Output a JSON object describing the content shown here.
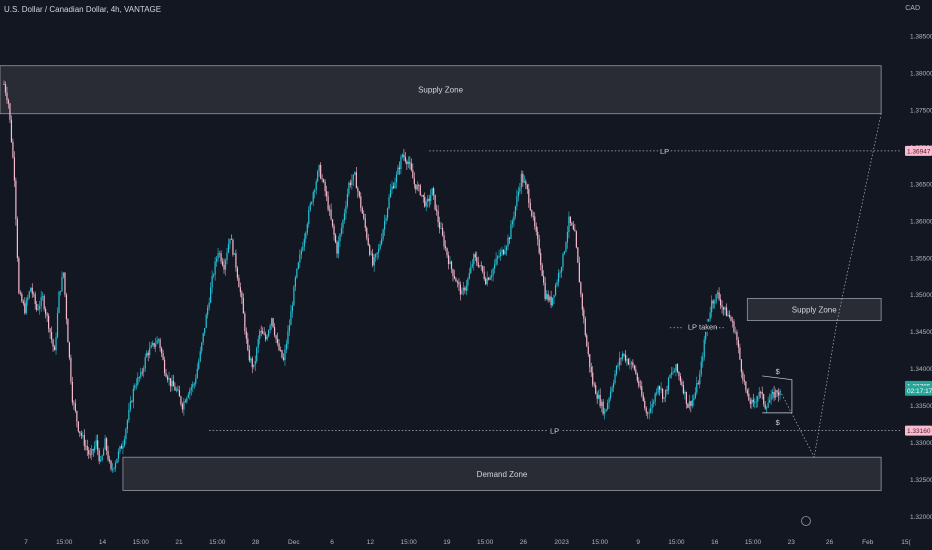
{
  "header": {
    "title": "U.S. Dollar / Canadian Dollar, 4h, VANTAGE",
    "currency": "CAD"
  },
  "colors": {
    "background": "#131722",
    "up": "#26c6da",
    "down": "#f8bbd0",
    "zone_fill": "#2e3038",
    "zone_border": "#9598a1",
    "text": "#d1d4dc",
    "dotted": "#b2b5be",
    "price_tag_pink": "#f8bbd0",
    "price_tag_teal": "#26a69a"
  },
  "chart_data": {
    "type": "candlestick",
    "symbol": "USDCAD",
    "timeframe": "4h",
    "ylim": [
      1.3195,
      1.388
    ],
    "y_ticks": [
      "1.38500",
      "1.38000",
      "1.37500",
      "1.37000",
      "1.36500",
      "1.36000",
      "1.35500",
      "1.35000",
      "1.34500",
      "1.34000",
      "1.33500",
      "1.33000",
      "1.32500",
      "1.32000"
    ],
    "x_ticks": [
      "7",
      "15:00",
      "14",
      "15:00",
      "21",
      "15:00",
      "28",
      "Dec",
      "6",
      "12",
      "15:00",
      "19",
      "15:00",
      "26",
      "2023",
      "15:00",
      "9",
      "15:00",
      "16",
      "15:00",
      "23",
      "26",
      "Feb",
      "15("
    ],
    "price_path": [
      [
        0,
        1.3785
      ],
      [
        3,
        1.376
      ],
      [
        7,
        1.366
      ],
      [
        10,
        1.35
      ],
      [
        14,
        1.348
      ],
      [
        18,
        1.351
      ],
      [
        22,
        1.348
      ],
      [
        26,
        1.3495
      ],
      [
        30,
        1.346
      ],
      [
        34,
        1.342
      ],
      [
        37,
        1.35
      ],
      [
        40,
        1.353
      ],
      [
        43,
        1.344
      ],
      [
        46,
        1.336
      ],
      [
        50,
        1.332
      ],
      [
        54,
        1.33
      ],
      [
        58,
        1.328
      ],
      [
        62,
        1.33
      ],
      [
        65,
        1.327
      ],
      [
        68,
        1.33
      ],
      [
        72,
        1.326
      ],
      [
        76,
        1.328
      ],
      [
        80,
        1.33
      ],
      [
        84,
        1.334
      ],
      [
        88,
        1.338
      ],
      [
        92,
        1.339
      ],
      [
        96,
        1.342
      ],
      [
        100,
        1.343
      ],
      [
        104,
        1.344
      ],
      [
        108,
        1.34
      ],
      [
        112,
        1.338
      ],
      [
        116,
        1.337
      ],
      [
        120,
        1.335
      ],
      [
        124,
        1.337
      ],
      [
        128,
        1.338
      ],
      [
        132,
        1.342
      ],
      [
        136,
        1.347
      ],
      [
        140,
        1.352
      ],
      [
        144,
        1.356
      ],
      [
        148,
        1.354
      ],
      [
        152,
        1.358
      ],
      [
        156,
        1.354
      ],
      [
        160,
        1.349
      ],
      [
        164,
        1.342
      ],
      [
        168,
        1.34
      ],
      [
        172,
        1.345
      ],
      [
        176,
        1.344
      ],
      [
        180,
        1.347
      ],
      [
        184,
        1.343
      ],
      [
        188,
        1.341
      ],
      [
        192,
        1.346
      ],
      [
        196,
        1.352
      ],
      [
        200,
        1.356
      ],
      [
        204,
        1.36
      ],
      [
        208,
        1.364
      ],
      [
        212,
        1.367
      ],
      [
        216,
        1.364
      ],
      [
        220,
        1.36
      ],
      [
        224,
        1.356
      ],
      [
        228,
        1.36
      ],
      [
        232,
        1.365
      ],
      [
        236,
        1.366
      ],
      [
        240,
        1.362
      ],
      [
        244,
        1.358
      ],
      [
        248,
        1.354
      ],
      [
        252,
        1.356
      ],
      [
        256,
        1.36
      ],
      [
        260,
        1.364
      ],
      [
        264,
        1.366
      ],
      [
        268,
        1.369
      ],
      [
        272,
        1.368
      ],
      [
        276,
        1.365
      ],
      [
        280,
        1.364
      ],
      [
        284,
        1.362
      ],
      [
        288,
        1.364
      ],
      [
        292,
        1.36
      ],
      [
        296,
        1.357
      ],
      [
        300,
        1.354
      ],
      [
        304,
        1.352
      ],
      [
        308,
        1.35
      ],
      [
        312,
        1.352
      ],
      [
        316,
        1.355
      ],
      [
        320,
        1.354
      ],
      [
        324,
        1.352
      ],
      [
        328,
        1.353
      ],
      [
        332,
        1.355
      ],
      [
        336,
        1.356
      ],
      [
        340,
        1.358
      ],
      [
        344,
        1.362
      ],
      [
        348,
        1.366
      ],
      [
        352,
        1.364
      ],
      [
        356,
        1.36
      ],
      [
        360,
        1.356
      ],
      [
        364,
        1.35
      ],
      [
        368,
        1.349
      ],
      [
        372,
        1.352
      ],
      [
        376,
        1.355
      ],
      [
        380,
        1.36
      ],
      [
        384,
        1.358
      ],
      [
        388,
        1.35
      ],
      [
        392,
        1.343
      ],
      [
        396,
        1.338
      ],
      [
        400,
        1.336
      ],
      [
        404,
        1.334
      ],
      [
        408,
        1.337
      ],
      [
        412,
        1.34
      ],
      [
        416,
        1.342
      ],
      [
        420,
        1.341
      ],
      [
        424,
        1.34
      ],
      [
        428,
        1.337
      ],
      [
        432,
        1.334
      ],
      [
        436,
        1.335
      ],
      [
        440,
        1.338
      ],
      [
        444,
        1.336
      ],
      [
        448,
        1.339
      ],
      [
        452,
        1.34
      ],
      [
        456,
        1.338
      ],
      [
        460,
        1.335
      ],
      [
        464,
        1.336
      ],
      [
        468,
        1.339
      ],
      [
        472,
        1.345
      ],
      [
        476,
        1.349
      ],
      [
        480,
        1.35
      ],
      [
        484,
        1.348
      ],
      [
        488,
        1.347
      ],
      [
        492,
        1.345
      ],
      [
        496,
        1.34
      ],
      [
        500,
        1.336
      ],
      [
        504,
        1.335
      ],
      [
        508,
        1.337
      ],
      [
        512,
        1.335
      ],
      [
        516,
        1.336
      ],
      [
        520,
        1.337
      ],
      [
        522,
        1.3365
      ]
    ],
    "zones": [
      {
        "label": "Supply Zone",
        "top": 1.381,
        "bottom": 1.3745,
        "x_start": 0,
        "x_end": 590
      },
      {
        "label": "Supply Zone",
        "top": 1.3495,
        "bottom": 1.3465,
        "x_start": 500,
        "x_end": 590
      },
      {
        "label": "Demand Zone",
        "top": 1.328,
        "bottom": 1.3235,
        "x_start": 80,
        "x_end": 590
      }
    ],
    "levels": [
      {
        "label": "LP",
        "price": 1.36947,
        "x_start": 286
      },
      {
        "label": "LP",
        "price": 1.3316,
        "x_start": 138
      }
    ],
    "annotations": [
      {
        "text": "LP taken",
        "price": 1.3458,
        "x": 460
      },
      {
        "text": "$",
        "price": 1.3398,
        "x": 519
      },
      {
        "text": "$",
        "price": 1.3329,
        "x": 519
      }
    ],
    "price_tags": [
      {
        "text": "1.36947",
        "price": 1.36947,
        "kind": "pink"
      },
      {
        "text": "1.33765",
        "price": 1.33765,
        "kind": "teal"
      },
      {
        "text": "02:17:17",
        "price": 1.337,
        "kind": "teal"
      },
      {
        "text": "1.33160",
        "price": 1.3316,
        "kind": "pink"
      }
    ],
    "projection": [
      [
        522,
        1.337
      ],
      [
        545,
        1.328
      ],
      [
        560,
        1.346
      ],
      [
        590,
        1.3745
      ]
    ]
  }
}
